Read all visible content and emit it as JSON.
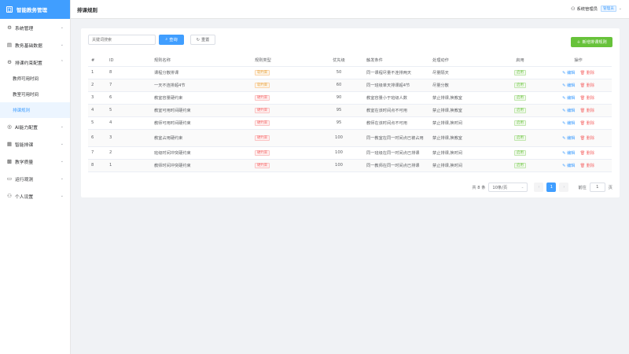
{
  "brand": {
    "logo": "囗",
    "name": "智能教务管理"
  },
  "sidebar": {
    "items": [
      {
        "label": "系统管理",
        "icon": "⚙",
        "chev": "⌄"
      },
      {
        "label": "教务基础数据",
        "icon": "▤",
        "chev": "⌄"
      },
      {
        "label": "排课约束配置",
        "icon": "⚙",
        "chev": "⌃"
      },
      {
        "label": "AI能力配置",
        "icon": "◎",
        "chev": "⌄"
      },
      {
        "label": "智能排课",
        "icon": "▦",
        "chev": "⌄"
      },
      {
        "label": "教学质量",
        "icon": "▩",
        "chev": "⌄"
      },
      {
        "label": "运行观测",
        "icon": "▭",
        "chev": "⌄"
      },
      {
        "label": "个人设置",
        "icon": "⚇",
        "chev": "⌄"
      }
    ],
    "sub_items": [
      "教师可用时间",
      "教室可用时间",
      "排课规则"
    ]
  },
  "header": {
    "title": "排课规则",
    "user": "系统管理员",
    "role": "管理员",
    "user_icon": "⚇",
    "chev": "⌄"
  },
  "toolbar": {
    "search_placeholder": "关键词搜索",
    "search_label": "查询",
    "reset_label": "重置",
    "add_label": "新增排课规则",
    "search_icon": "⌕",
    "reset_icon": "↻",
    "add_icon": "＋"
  },
  "table": {
    "headers": [
      "#",
      "ID",
      "规则名称",
      "规则类型",
      "优先级",
      "触发条件",
      "处理动作",
      "启用",
      "操作"
    ],
    "edit_label": "编辑",
    "delete_label": "删除",
    "edit_icon": "✎",
    "delete_icon": "🗑",
    "rows": [
      {
        "idx": "1",
        "id": "8",
        "name": "课程分散排课",
        "type": "软约束",
        "type_color": "orange",
        "priority": "50",
        "condition": "同一课程尽量不连排两天",
        "action": "尽量隔天",
        "enabled": "启用"
      },
      {
        "idx": "2",
        "id": "7",
        "name": "一天不连排超4节",
        "type": "软约束",
        "type_color": "orange",
        "priority": "60",
        "condition": "同一班级单天排课超4节",
        "action": "尽量分散",
        "enabled": "启用"
      },
      {
        "idx": "3",
        "id": "6",
        "name": "教室容量硬约束",
        "type": "硬约束",
        "type_color": "red",
        "priority": "90",
        "condition": "教室容量小于班级人数",
        "action": "禁止排课,换教室",
        "enabled": "启用"
      },
      {
        "idx": "4",
        "id": "5",
        "name": "教室可用时间硬约束",
        "type": "硬约束",
        "type_color": "red",
        "priority": "95",
        "condition": "教室在该时间点不可用",
        "action": "禁止排课,换教室",
        "enabled": "启用"
      },
      {
        "idx": "5",
        "id": "4",
        "name": "教师可用时间硬约束",
        "type": "硬约束",
        "type_color": "red",
        "priority": "95",
        "condition": "教师在该时间点不可用",
        "action": "禁止排课,换时间",
        "enabled": "启用"
      },
      {
        "idx": "6",
        "id": "3",
        "name": "教室占用硬约束",
        "type": "硬约束",
        "type_color": "red",
        "priority": "100",
        "condition": "同一教室在同一时间点已被占用",
        "action": "禁止排课,换教室",
        "enabled": "启用",
        "tall": true
      },
      {
        "idx": "7",
        "id": "2",
        "name": "班级时间冲突硬约束",
        "type": "硬约束",
        "type_color": "red",
        "priority": "100",
        "condition": "同一班级在同一时间点已排课",
        "action": "禁止排课,换时间",
        "enabled": "启用"
      },
      {
        "idx": "8",
        "id": "1",
        "name": "教师时间冲突硬约束",
        "type": "硬约束",
        "type_color": "red",
        "priority": "100",
        "condition": "同一教师在同一时间点已排课",
        "action": "禁止排课,换时间",
        "enabled": "启用"
      }
    ]
  },
  "pagination": {
    "total": "共 8 条",
    "page_size": "10条/页",
    "prev": "‹",
    "current_page": "1",
    "next": "›",
    "goto_label": "前往",
    "goto_value": "1",
    "page_unit": "页",
    "chev": "⌄"
  },
  "colors": {
    "primary": "#409eff",
    "success": "#67c23a",
    "danger": "#f56c6c",
    "warning": "#e6a23c"
  }
}
